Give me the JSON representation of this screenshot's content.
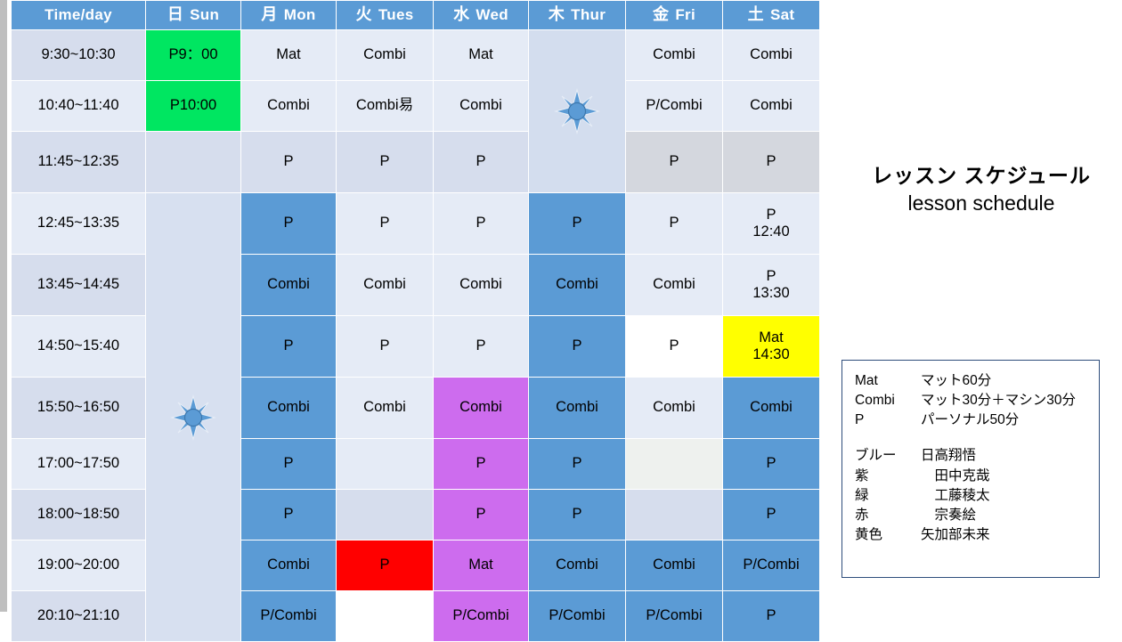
{
  "title": {
    "jp": "レッスン スケジュール",
    "en": "lesson schedule"
  },
  "table": {
    "headers": [
      {
        "kanji": "",
        "label": "Time/day"
      },
      {
        "kanji": "日",
        "label": "Sun"
      },
      {
        "kanji": "月",
        "label": "Mon"
      },
      {
        "kanji": "火",
        "label": "Tues"
      },
      {
        "kanji": "水",
        "label": "Wed"
      },
      {
        "kanji": "木",
        "label": "Thur"
      },
      {
        "kanji": "金",
        "label": "Fri"
      },
      {
        "kanji": "土",
        "label": "Sat"
      }
    ],
    "times": [
      "9:30~10:30",
      "10:40~11:40",
      "11:45~12:35",
      "12:45~13:35",
      "13:45~14:45",
      "14:50~15:40",
      "15:50~16:50",
      "17:00~17:50",
      "18:00~18:50",
      "19:00~20:00",
      "20:10~21:10"
    ],
    "rows": [
      {
        "sun": "P9：00",
        "mon": "Mat",
        "tue": "Combi",
        "wed": "Mat",
        "thu": "",
        "fri": "Combi",
        "sat": "",
        "sat2": "Combi"
      },
      {
        "sun": "P10:00",
        "mon": "Combi",
        "tue": "Combi易",
        "wed": "Combi",
        "thu": "",
        "fri": "P/Combi",
        "sat": "",
        "sat2": "Combi"
      },
      {
        "sun": "",
        "mon": "P",
        "tue": "P",
        "wed": "P",
        "thu": "",
        "fri": "P",
        "sat": "",
        "sat2": "P"
      },
      {
        "sun": "",
        "mon": "P",
        "tue": "P",
        "wed": "P",
        "thu": "P",
        "fri": "P",
        "sat": "P",
        "sat2": "12:40"
      },
      {
        "sun": "",
        "mon": "Combi",
        "tue": "Combi",
        "wed": "Combi",
        "thu": "Combi",
        "fri": "Combi",
        "sat": "P",
        "sat2": "13:30"
      },
      {
        "sun": "",
        "mon": "P",
        "tue": "P",
        "wed": "P",
        "thu": "P",
        "fri": "P",
        "sat": "Mat",
        "sat2": "14:30"
      },
      {
        "sun": "",
        "mon": "Combi",
        "tue": "Combi",
        "wed": "Combi",
        "thu": "Combi",
        "fri": "Combi",
        "sat": "",
        "sat2": "Combi"
      },
      {
        "sun": "",
        "mon": "P",
        "tue": "",
        "wed": "P",
        "thu": "P",
        "fri": "",
        "sat": "",
        "sat2": "P"
      },
      {
        "sun": "",
        "mon": "P",
        "tue": "",
        "wed": "P",
        "thu": "P",
        "fri": "",
        "sat": "",
        "sat2": "P"
      },
      {
        "sun": "",
        "mon": "Combi",
        "tue": "P",
        "wed": "Mat",
        "thu": "Combi",
        "fri": "Combi",
        "sat": "",
        "sat2": "P/Combi"
      },
      {
        "sun": "",
        "mon": "P/Combi",
        "tue": "",
        "wed": "P/Combi",
        "thu": "P/Combi",
        "fri": "P/Combi",
        "sat": "",
        "sat2": "P"
      }
    ]
  },
  "legend": {
    "classes": [
      {
        "key": "Mat",
        "value": "マット60分"
      },
      {
        "key": "Combi",
        "value": "マット30分＋マシン30分"
      },
      {
        "key": "P",
        "value": "パーソナル50分"
      }
    ],
    "people": [
      {
        "key": "ブルー",
        "value": "日高翔悟"
      },
      {
        "key": "紫",
        "value": "　田中克哉"
      },
      {
        "key": "緑",
        "value": "　工藤稜太"
      },
      {
        "key": "赤",
        "value": "　宗奏絵"
      },
      {
        "key": "黄色",
        "value": " 矢加部未来"
      }
    ]
  },
  "colors": {
    "header_blue": "#5b9bd5",
    "cell_blue": "#5b9bd5",
    "cell_green": "#00e661",
    "cell_purple": "#cd6cee",
    "cell_yellow": "#ffff00",
    "cell_red": "#ff0000",
    "row_alt_a": "#d6dded",
    "row_alt_b": "#e5ebf6",
    "legend_border": "#2e4d7b"
  },
  "icons": {
    "sun_thursday": "sun-icon",
    "sun_sunday": "sun-icon"
  }
}
